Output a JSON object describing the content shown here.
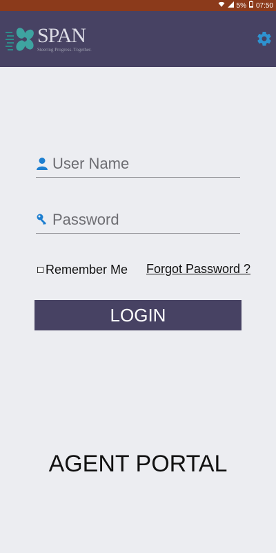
{
  "status_bar": {
    "battery": "5%",
    "time": "07:50",
    "color": "#8B3A1B"
  },
  "header": {
    "logo_word": "SPAN",
    "logo_tagline": "Steering Progress. Together.",
    "settings_icon": "gear-icon",
    "background": "#474263",
    "accent": "#2E93D1"
  },
  "form": {
    "username_placeholder": "User Name",
    "password_placeholder": "Password",
    "remember_label": "Remember Me",
    "remember_checked": false,
    "forgot_label": "Forgot Password ?",
    "login_label": "LOGIN"
  },
  "footer": {
    "portal_title": "AGENT PORTAL"
  }
}
